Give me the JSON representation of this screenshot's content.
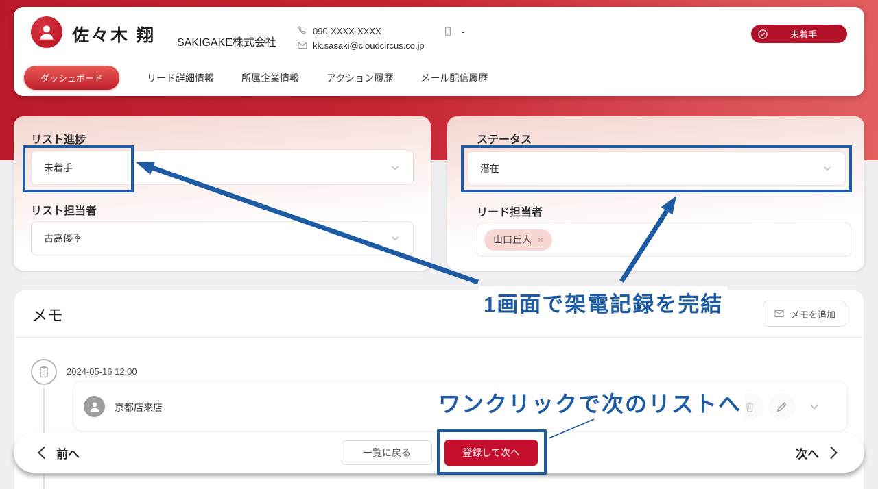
{
  "colors": {
    "brand_red": "#c52431",
    "badge_red": "#b2122a",
    "button_red": "#c60f2e",
    "annotation_blue": "#1d5ca4",
    "tag_pink": "#f7d8d4",
    "page_gray": "#f0eff1"
  },
  "icons": {
    "avatar": "person-icon",
    "phone": "phone-icon",
    "email": "envelope-icon",
    "mobile": "mobile-icon",
    "badge": "check-circle-icon",
    "select": "chevron-down-icon",
    "memo_add": "envelope-icon",
    "timeline": "clipboard-icon",
    "note_delete": "trash-icon",
    "note_edit": "pencil-icon",
    "nav_prev": "chevron-left-icon",
    "nav_next": "chevron-right-icon"
  },
  "header": {
    "name": "佐々木 翔",
    "company": "SAKIGAKE株式会社",
    "phone": "090-XXXX-XXXX",
    "email": "kk.sasaki@cloudcircus.co.jp",
    "mobile_value": "-",
    "badge": "未着手",
    "tabs": [
      {
        "label": "ダッシュボード",
        "active": true
      },
      {
        "label": "リード詳細情報",
        "active": false
      },
      {
        "label": "所属企業情報",
        "active": false
      },
      {
        "label": "アクション履歴",
        "active": false
      },
      {
        "label": "メール配信履歴",
        "active": false
      }
    ]
  },
  "list_panel": {
    "progress_label": "リスト進捗",
    "progress_value": "未着手",
    "owner_label": "リスト担当者",
    "owner_value": "古高優季"
  },
  "status_panel": {
    "status_label": "ステータス",
    "status_value": "潜在",
    "owner_label": "リード担当者",
    "owner_tag": "山口丘人",
    "tag_remove": "×"
  },
  "memo": {
    "title": "メモ",
    "add_button": "メモを追加",
    "entry": {
      "timestamp": "2024-05-16 12:00",
      "text": "京都店来店"
    }
  },
  "footer": {
    "prev": "前へ",
    "back_to_list": "一覧に戻る",
    "register_next": "登録して次へ",
    "next": "次へ"
  },
  "annotations": {
    "callout1": "1画面で架電記録を完結",
    "callout2": "ワンクリックで次のリストへ"
  }
}
